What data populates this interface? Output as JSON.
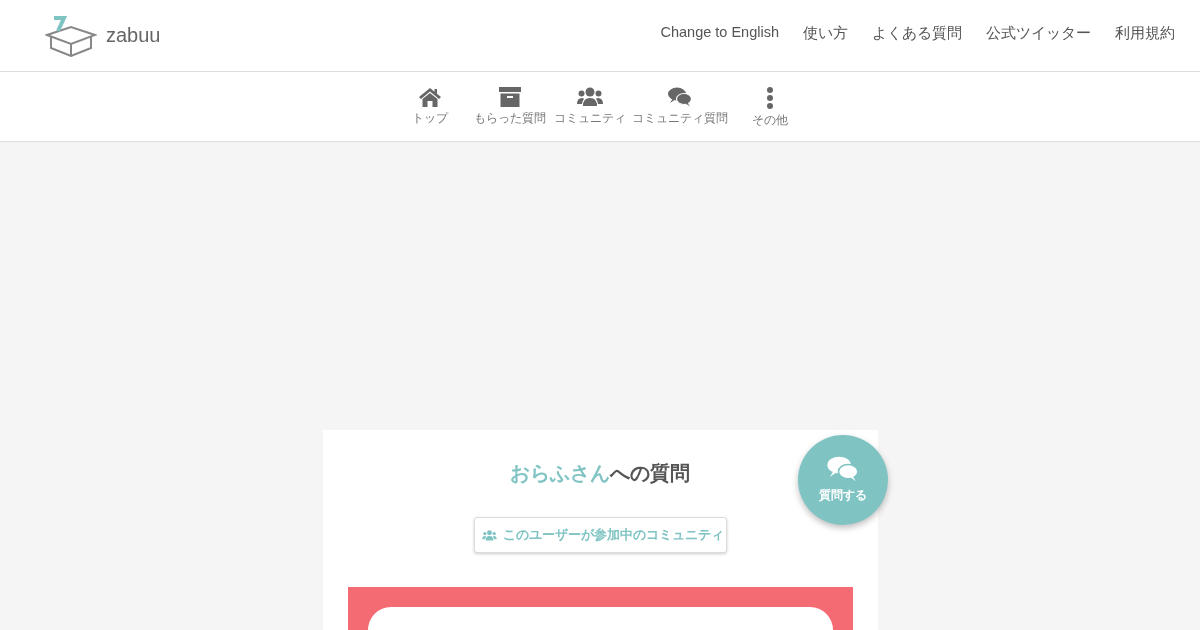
{
  "header": {
    "brand": "zabuu",
    "links": [
      "Change to English",
      "使い方",
      "よくある質問",
      "公式ツイッター",
      "利用規約"
    ]
  },
  "nav": [
    {
      "kind": "home",
      "label": "トップ"
    },
    {
      "kind": "archive",
      "label": "もらった質問"
    },
    {
      "kind": "users",
      "label": "コミュニティ"
    },
    {
      "kind": "chat",
      "label": "コミュニティ質問"
    },
    {
      "kind": "more",
      "label": "その他"
    }
  ],
  "card": {
    "user_name": "おらふさん",
    "title_suffix": "への質問",
    "community_button": "このユーザーが参加中のコミュニティ"
  },
  "fab": {
    "label": "質問する"
  }
}
